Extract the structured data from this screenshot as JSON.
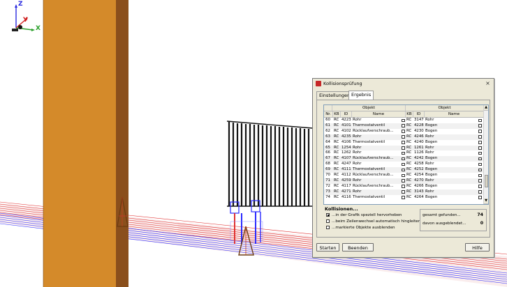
{
  "axes": {
    "z": "Z",
    "y": "Y",
    "x": "X"
  },
  "colors": {
    "column": "#d48a2a",
    "column_dark": "#8a4f1c",
    "pipe_blue": "#2a2aff",
    "pipe_red": "#e03030",
    "fitting_dark": "#6b3a10"
  },
  "dialog": {
    "title": "Kollisionsprüfung",
    "close": "×",
    "tabs": [
      {
        "label": "Einstellungen",
        "active": false
      },
      {
        "label": "Ergebnis",
        "active": true
      }
    ],
    "grid": {
      "group_left": "Objekt",
      "group_right": "Objekt",
      "columns": [
        "Nr.",
        "KB",
        "ID",
        "Name",
        "KB",
        "ID",
        "Name"
      ],
      "rows": [
        [
          "60",
          "RC",
          "4223",
          "Rohr",
          "RC",
          "3147",
          "Rohr"
        ],
        [
          "61",
          "RC",
          "4101",
          "Thermostatventil",
          "RC",
          "4228",
          "Bogen"
        ],
        [
          "62",
          "RC",
          "4102",
          "Rücklaufverschraub...",
          "RC",
          "4230",
          "Bogen"
        ],
        [
          "63",
          "RC",
          "4235",
          "Rohr",
          "RC",
          "4246",
          "Rohr"
        ],
        [
          "64",
          "RC",
          "4106",
          "Thermostatventil",
          "RC",
          "4240",
          "Bogen"
        ],
        [
          "65",
          "RC",
          "1254",
          "Rohr",
          "RC",
          "1261",
          "Rohr"
        ],
        [
          "66",
          "RC",
          "1262",
          "Rohr",
          "RC",
          "1126",
          "Rohr"
        ],
        [
          "67",
          "RC",
          "4107",
          "Rücklaufverschraub...",
          "RC",
          "4242",
          "Bogen"
        ],
        [
          "68",
          "RC",
          "4247",
          "Rohr",
          "RC",
          "4258",
          "Rohr"
        ],
        [
          "69",
          "RC",
          "4111",
          "Thermostatventil",
          "RC",
          "4252",
          "Bogen"
        ],
        [
          "70",
          "RC",
          "4112",
          "Rücklaufverschraub...",
          "RC",
          "4254",
          "Bogen"
        ],
        [
          "71",
          "RC",
          "4259",
          "Rohr",
          "RC",
          "4270",
          "Rohr"
        ],
        [
          "72",
          "RC",
          "4117",
          "Rücklaufverschraub...",
          "RC",
          "4266",
          "Bogen"
        ],
        [
          "73",
          "RC",
          "4271",
          "Rohr",
          "RC",
          "3143",
          "Rohr"
        ],
        [
          "74",
          "RC",
          "4116",
          "Thermostatventil",
          "RC",
          "4264",
          "Bogen"
        ]
      ]
    },
    "kollisionen": {
      "heading": "Kollisionen...",
      "opt1": "...in der Grafik speziell hervorheben",
      "opt1_checked": true,
      "opt2": "...beim Zeilenwechsel automatisch hingleiten",
      "opt2_checked": false,
      "opt3": "...markierte Objekte ausblenden",
      "opt3_checked": false,
      "found_label": "gesamt gefunden...",
      "found_value": "74",
      "hidden_label": "davon ausgeblendet...",
      "hidden_value": "0"
    },
    "buttons": {
      "start": "Starten",
      "end": "Beenden",
      "help": "Hilfe"
    }
  }
}
